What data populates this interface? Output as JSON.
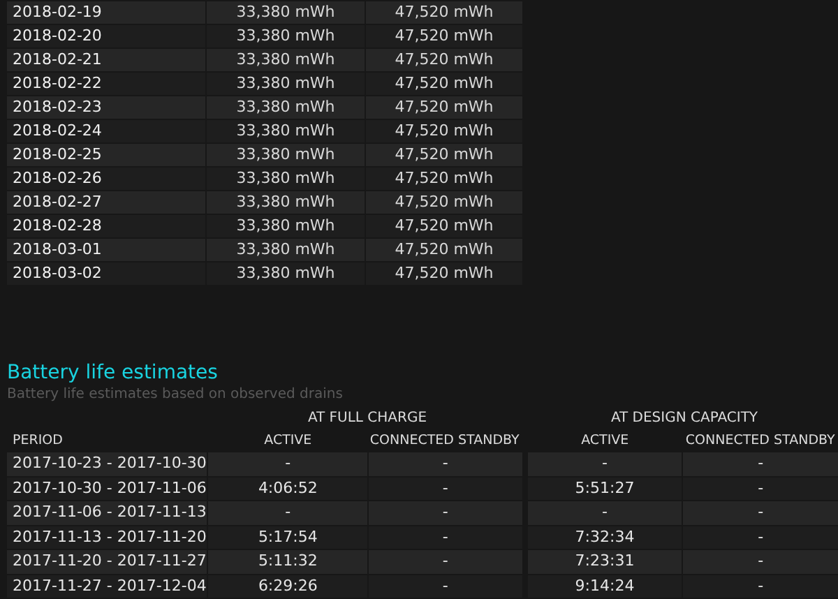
{
  "capacity_history": {
    "rows": [
      [
        "2018-02-19",
        "33,380 mWh",
        "47,520 mWh"
      ],
      [
        "2018-02-20",
        "33,380 mWh",
        "47,520 mWh"
      ],
      [
        "2018-02-21",
        "33,380 mWh",
        "47,520 mWh"
      ],
      [
        "2018-02-22",
        "33,380 mWh",
        "47,520 mWh"
      ],
      [
        "2018-02-23",
        "33,380 mWh",
        "47,520 mWh"
      ],
      [
        "2018-02-24",
        "33,380 mWh",
        "47,520 mWh"
      ],
      [
        "2018-02-25",
        "33,380 mWh",
        "47,520 mWh"
      ],
      [
        "2018-02-26",
        "33,380 mWh",
        "47,520 mWh"
      ],
      [
        "2018-02-27",
        "33,380 mWh",
        "47,520 mWh"
      ],
      [
        "2018-02-28",
        "33,380 mWh",
        "47,520 mWh"
      ],
      [
        "2018-03-01",
        "33,380 mWh",
        "47,520 mWh"
      ],
      [
        "2018-03-02",
        "33,380 mWh",
        "47,520 mWh"
      ]
    ]
  },
  "battery_life": {
    "title": "Battery life estimates",
    "subtitle": "Battery life estimates based on observed drains",
    "groups": [
      "AT FULL CHARGE",
      "AT DESIGN CAPACITY"
    ],
    "columns": [
      "PERIOD",
      "ACTIVE",
      "CONNECTED STANDBY",
      "ACTIVE",
      "CONNECTED STANDBY"
    ],
    "rows": [
      [
        "2017-10-23 - 2017-10-30",
        "-",
        "-",
        "-",
        "-"
      ],
      [
        "2017-10-30 - 2017-11-06",
        "4:06:52",
        "-",
        "5:51:27",
        "-"
      ],
      [
        "2017-11-06 - 2017-11-13",
        "-",
        "-",
        "-",
        "-"
      ],
      [
        "2017-11-13 - 2017-11-20",
        "5:17:54",
        "-",
        "7:32:34",
        "-"
      ],
      [
        "2017-11-20 - 2017-11-27",
        "5:11:32",
        "-",
        "7:23:31",
        "-"
      ],
      [
        "2017-11-27 - 2017-12-04",
        "6:29:26",
        "-",
        "9:14:24",
        "-"
      ]
    ]
  }
}
